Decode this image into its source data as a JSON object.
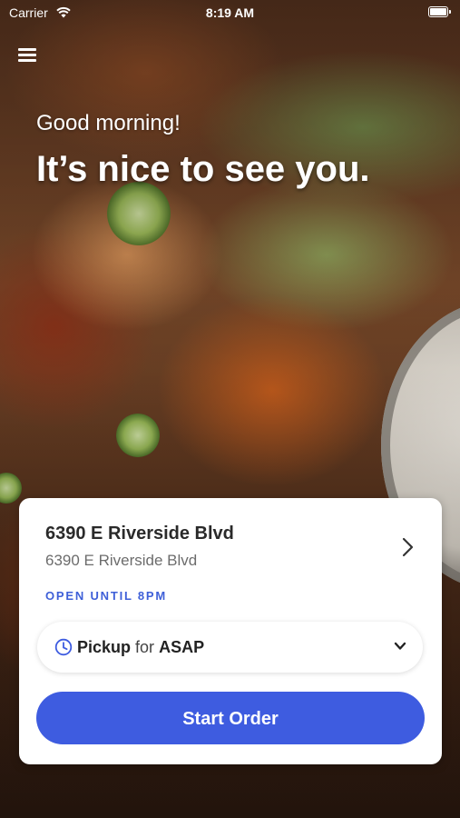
{
  "status_bar": {
    "carrier": "Carrier",
    "time": "8:19 AM"
  },
  "greeting": {
    "line1": "Good morning!",
    "line2": "It’s nice to see you."
  },
  "location": {
    "name": "6390 E Riverside Blvd",
    "address": "6390 E Riverside Blvd",
    "hours": "OPEN UNTIL 8PM"
  },
  "order_type": {
    "mode": "Pickup",
    "connector": "for",
    "time": "ASAP"
  },
  "actions": {
    "start_order": "Start Order"
  },
  "colors": {
    "accent": "#3e5ce0",
    "hours_text": "#3e5fd8"
  },
  "icons": [
    "menu-icon",
    "wifi-icon",
    "battery-icon",
    "chevron-right-icon",
    "clock-icon",
    "chevron-down-icon"
  ]
}
